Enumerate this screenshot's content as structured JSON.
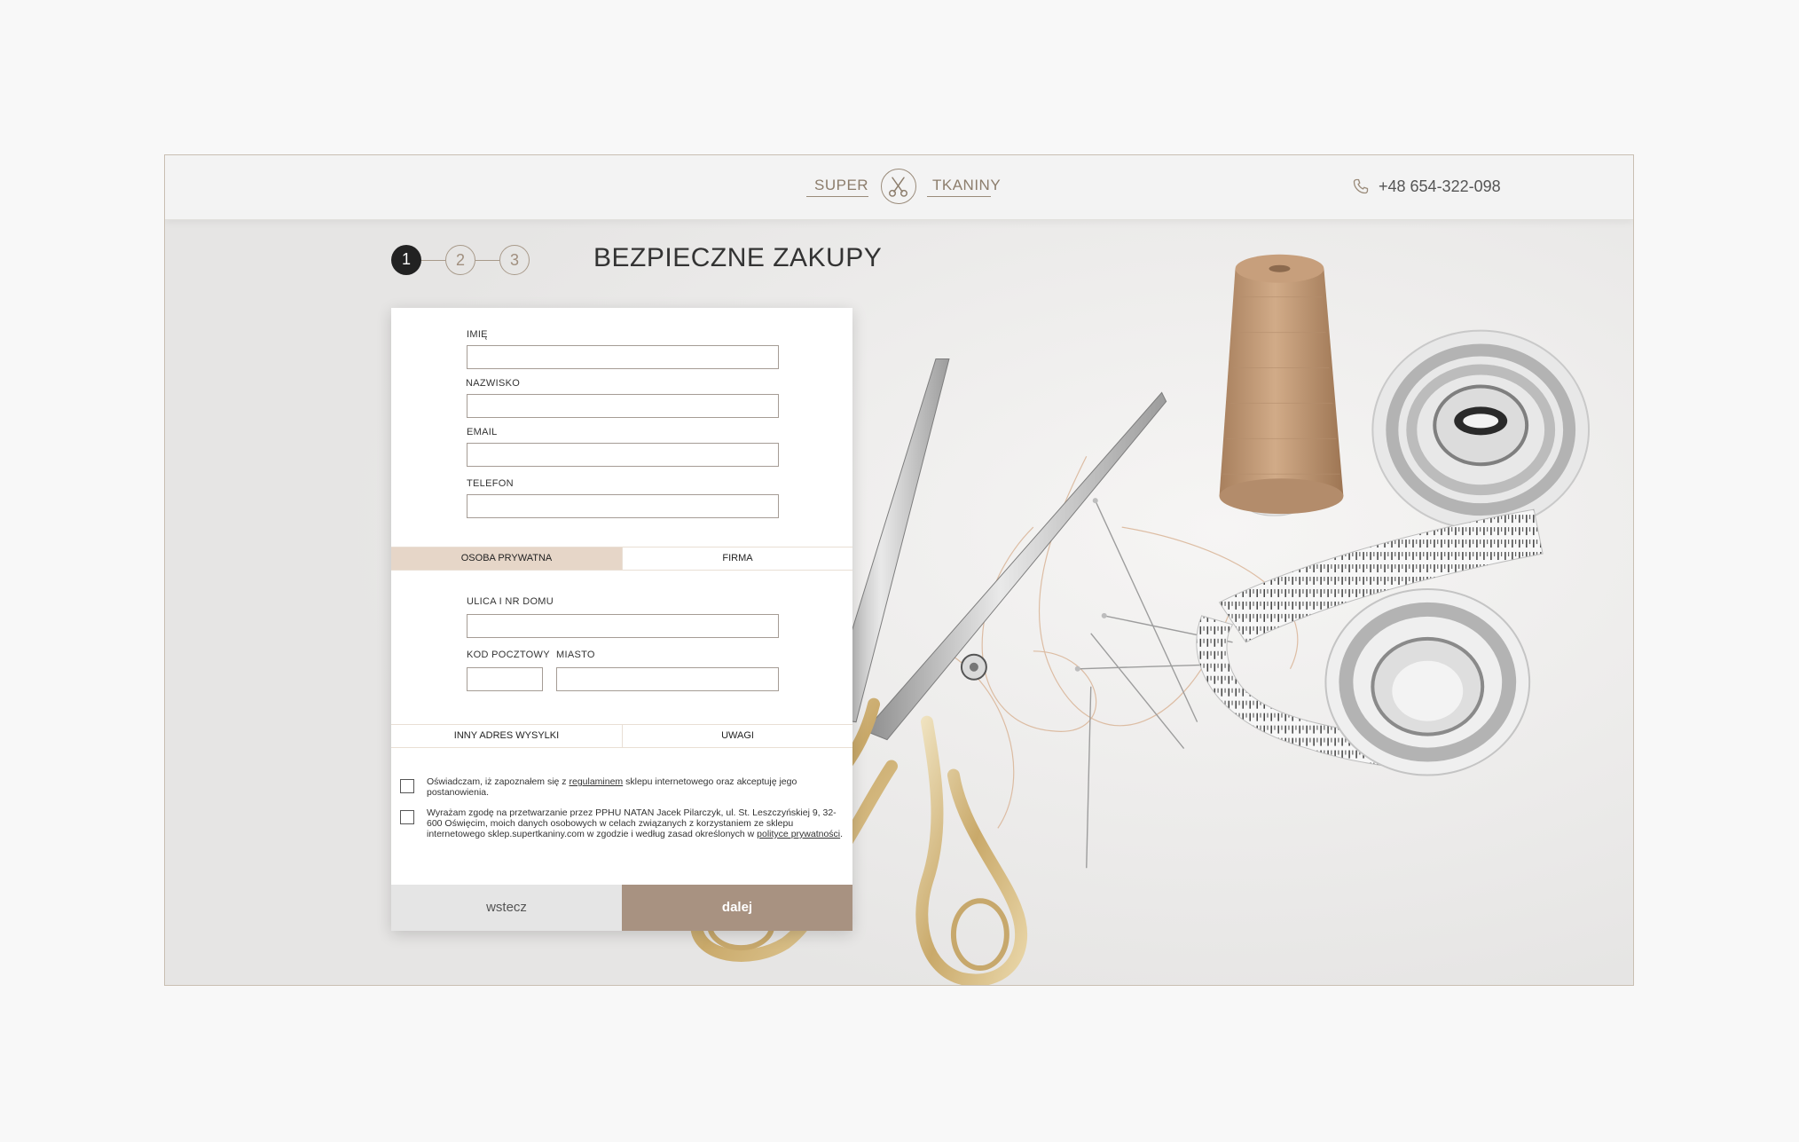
{
  "brand": {
    "left_word": "SUPER",
    "right_word": "TKANINY",
    "emblem": "scissors-icon"
  },
  "header": {
    "phone_icon": "phone-icon",
    "phone": "+48 654-322-098"
  },
  "steps": [
    {
      "label": "1",
      "active": true
    },
    {
      "label": "2",
      "active": false
    },
    {
      "label": "3",
      "active": false
    }
  ],
  "page_title": "BEZPIECZNE ZAKUPY",
  "form": {
    "fields": {
      "first_name": "IMIĘ",
      "last_name": "NAZWISKO",
      "email": "EMAIL",
      "phone": "TELEFON"
    },
    "customer_tabs": [
      {
        "label": "OSOBA PRYWATNA",
        "active": true
      },
      {
        "label": "FIRMA",
        "active": false
      }
    ],
    "address": {
      "street": "ULICA I NR DOMU",
      "postal_code": "KOD POCZTOWY",
      "city": "MIASTO"
    },
    "extra_tabs": [
      {
        "label": "INNY ADRES WYSYLKI"
      },
      {
        "label": "UWAGI"
      }
    ],
    "consents": [
      {
        "before": "Oświadczam, iż zapoznałem się z ",
        "link": "regulaminem",
        "after": " sklepu internetowego oraz akceptuję jego postanowienia.",
        "checked": false
      },
      {
        "before": "Wyrażam zgodę na przetwarzanie przez PPHU NATAN Jacek Pilarczyk, ul. St. Leszczyńskiej 9, 32-600 Oświęcim, moich danych osobowych w celach związanych z korzystaniem ze sklepu internetowego sklep.supertkaniny.com w zgodzie i według zasad określonych w ",
        "link": "polityce prywatności",
        "after": ".",
        "checked": false
      }
    ],
    "back_label": "wstecz",
    "next_label": "dalej"
  },
  "colors": {
    "accent": "#a89281",
    "tab_active": "#e6d6c8",
    "frame_border": "#c9bfb2"
  }
}
